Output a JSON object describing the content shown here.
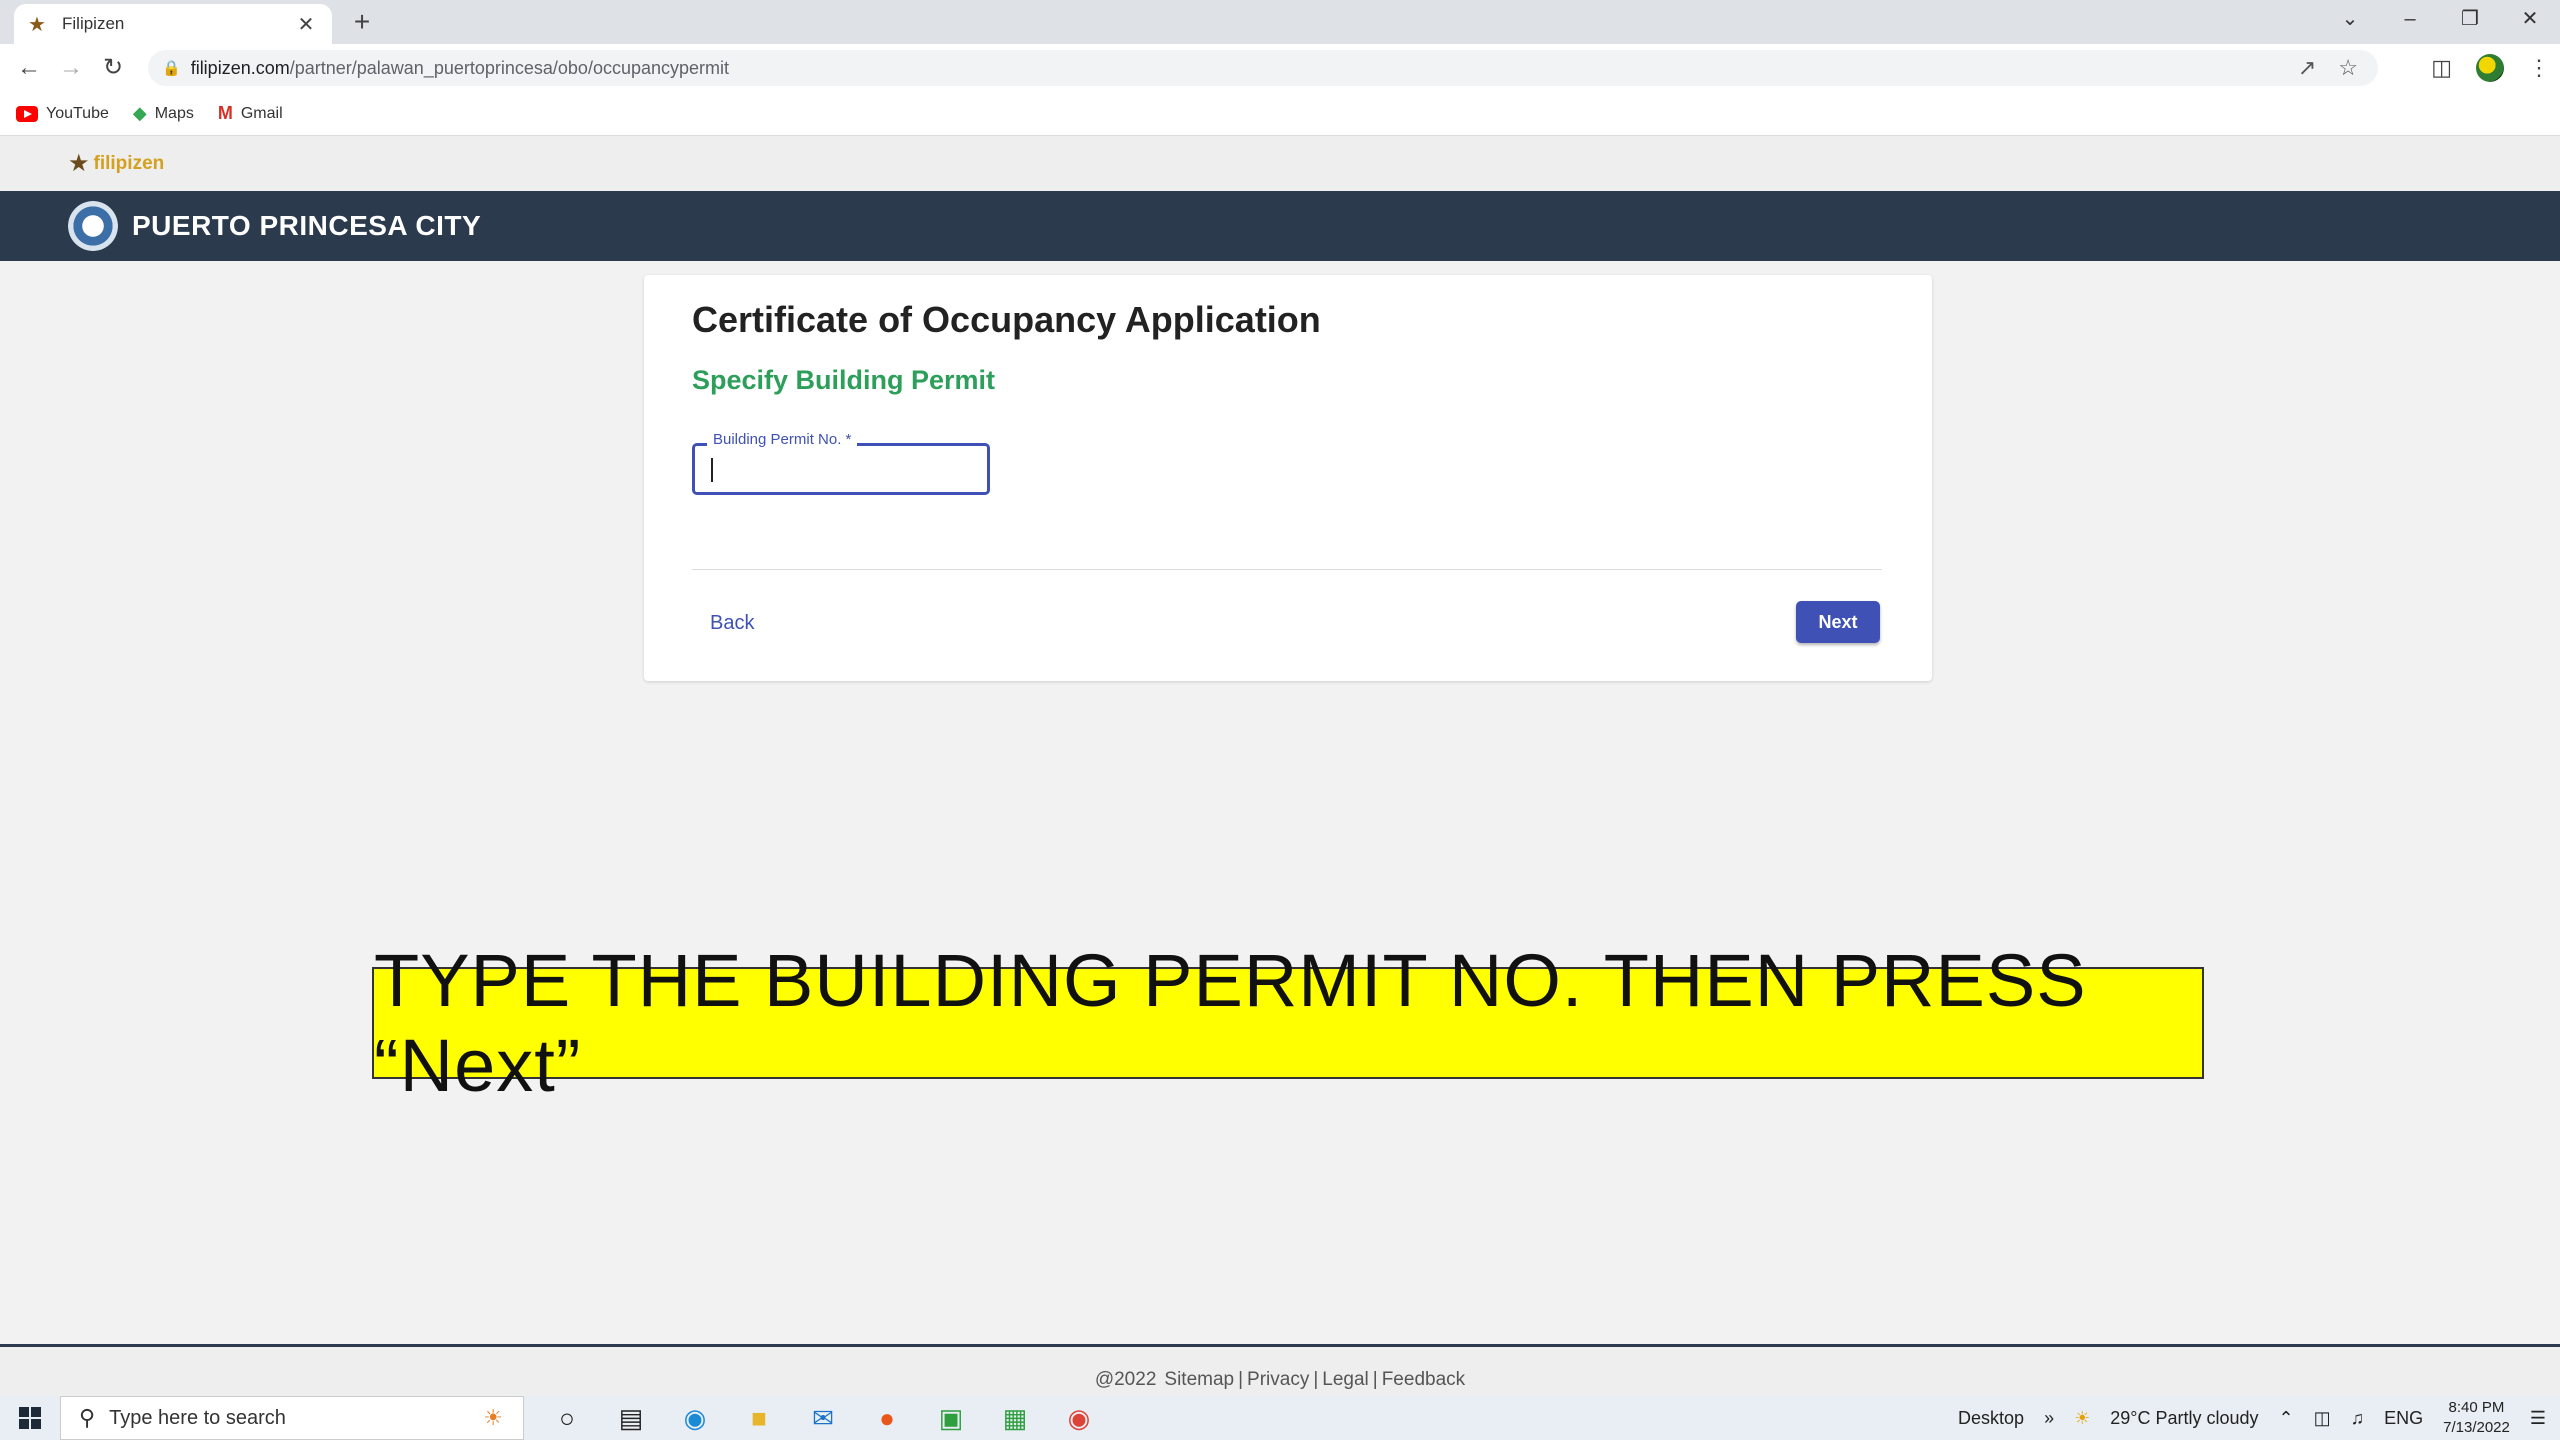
{
  "browser": {
    "tab_title": "Filipizen",
    "url_host": "filipizen.com",
    "url_path": "/partner/palawan_puertoprincesa/obo/occupancypermit",
    "bookmarks": [
      {
        "label": "YouTube"
      },
      {
        "label": "Maps"
      },
      {
        "label": "Gmail"
      }
    ]
  },
  "header": {
    "brand": "filipizen",
    "city": "PUERTO PRINCESA CITY"
  },
  "form": {
    "title": "Certificate of Occupancy Application",
    "subtitle": "Specify Building Permit",
    "permit_label": "Building Permit No. *",
    "permit_value": "",
    "back_label": "Back",
    "next_label": "Next"
  },
  "instruction": "TYPE THE BUILDING PERMIT NO. THEN PRESS “Next”",
  "footer": {
    "copyright": "@2022",
    "links": [
      "Sitemap",
      "Privacy",
      "Legal",
      "Feedback"
    ]
  },
  "taskbar": {
    "search_placeholder": "Type here to search",
    "desktop_label": "Desktop",
    "weather": "29°C  Partly cloudy",
    "language": "ENG",
    "time": "8:40 PM",
    "date": "7/13/2022"
  }
}
